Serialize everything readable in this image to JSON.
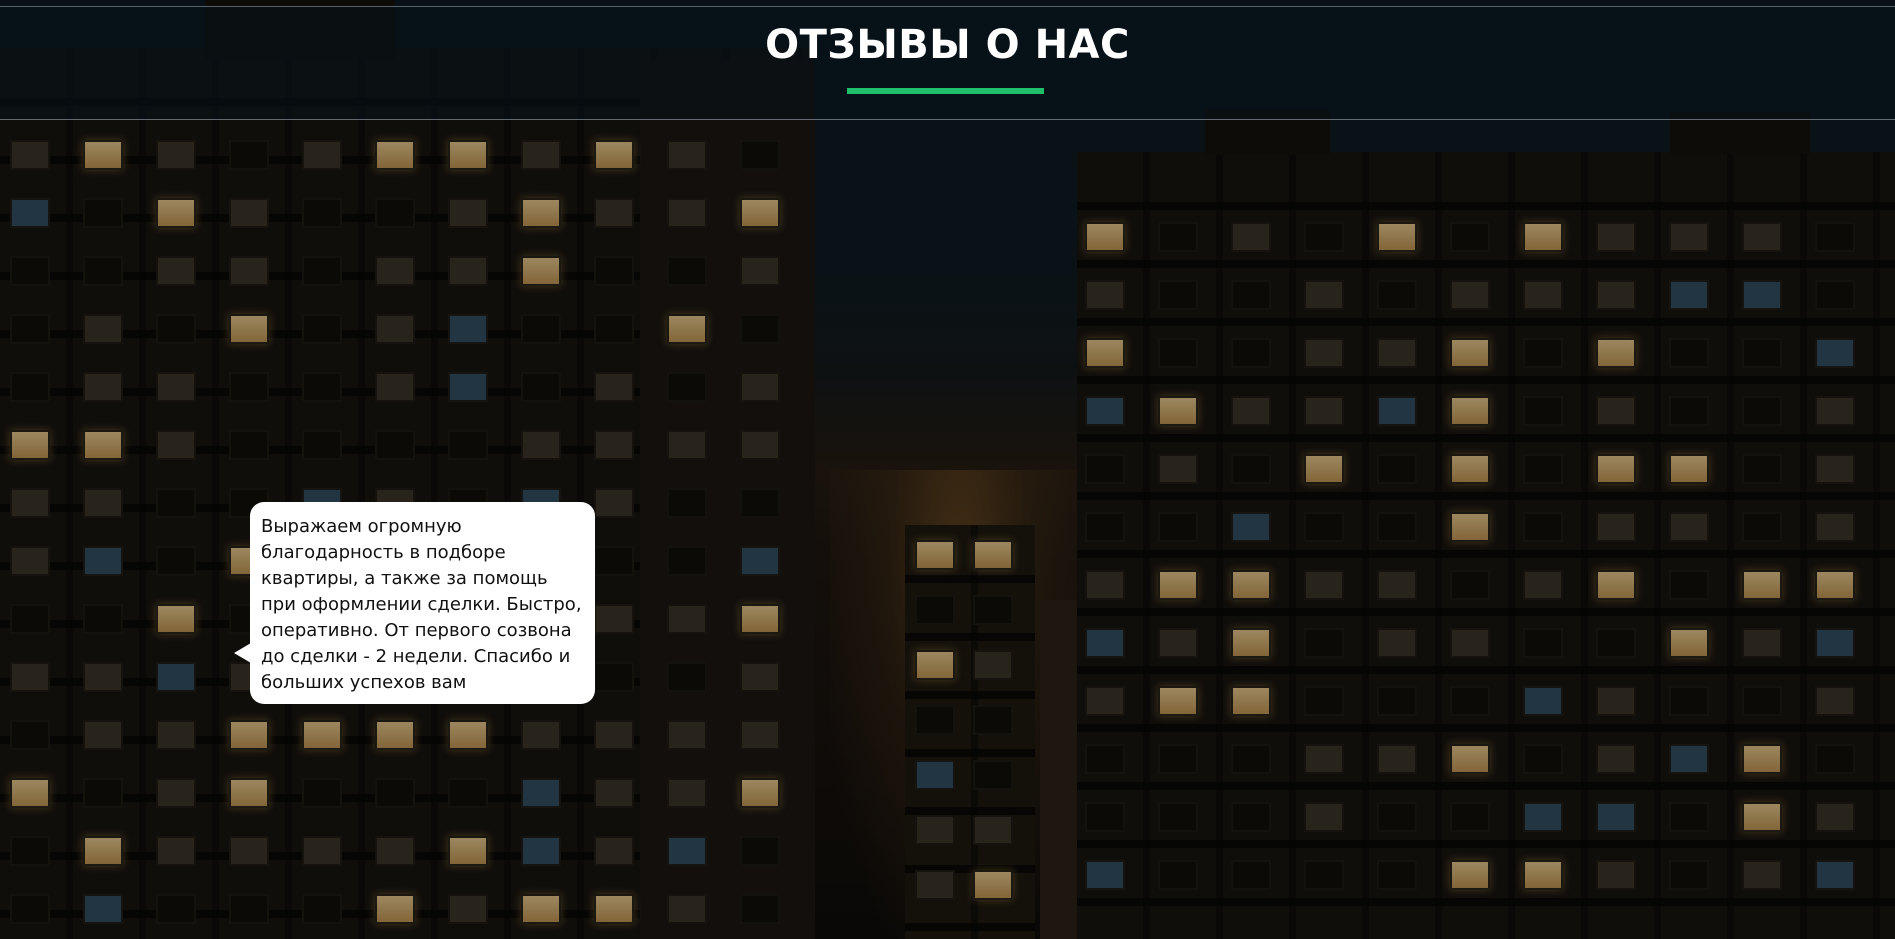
{
  "section": {
    "title": "ОТЗЫВЫ О НАС",
    "accent_color": "#1fbf6a"
  },
  "reviews": [
    {
      "text": "Выражаем огромную благодарность в подборе квартиры, а также за помощь при оформлении сделки. Быстро, оперативно. От первого созвона до сделки - 2 недели. Спасибо и больших успехов вам"
    }
  ],
  "background": {
    "description_icon": "night-apartment-buildings-photo"
  }
}
